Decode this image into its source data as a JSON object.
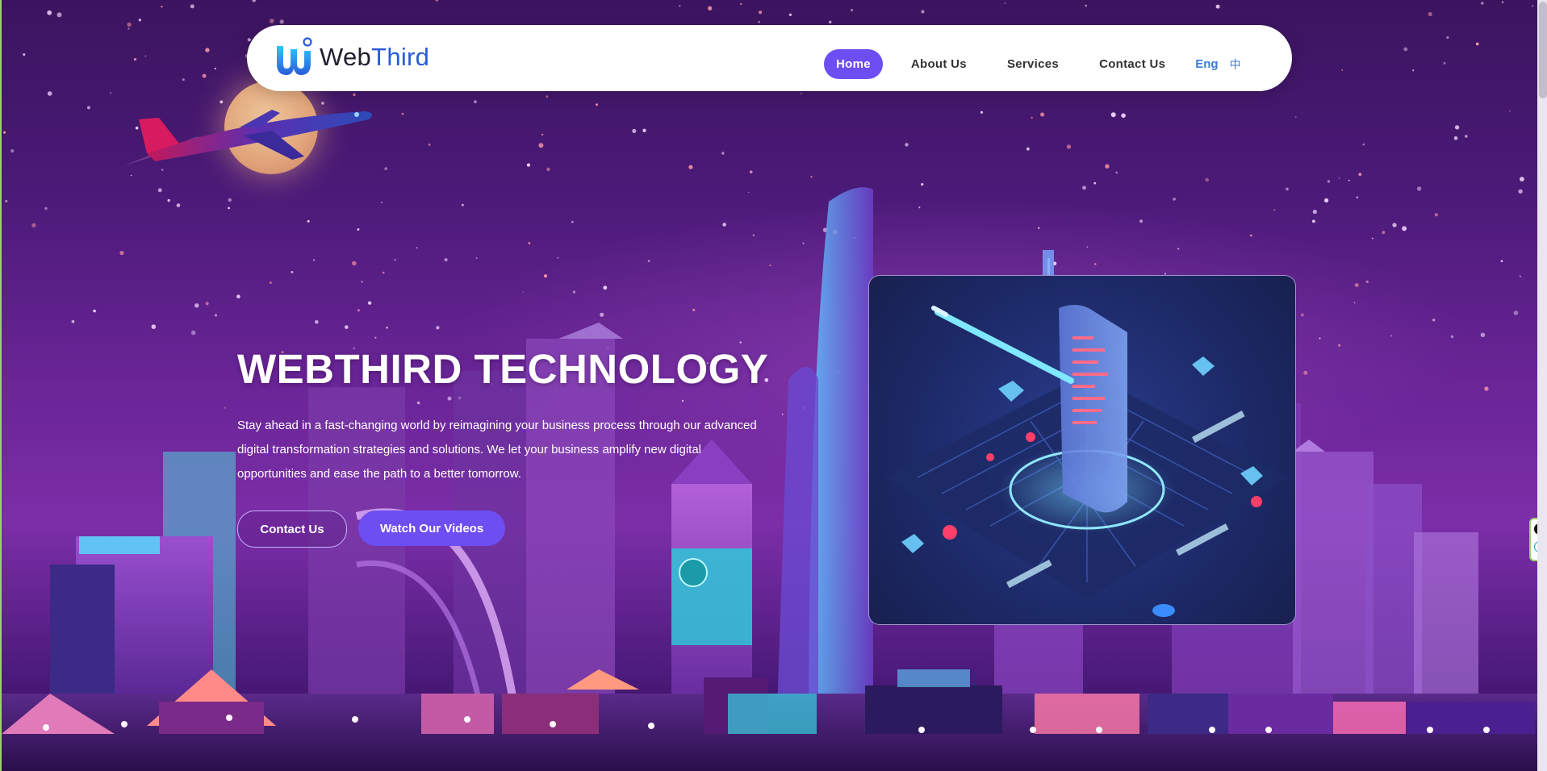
{
  "brand": {
    "logo_text_web": "Web",
    "logo_text_third": "Third",
    "logo_mark_letter": "W"
  },
  "nav": {
    "items": [
      {
        "label": "Home",
        "active": true
      },
      {
        "label": "About Us",
        "active": false
      },
      {
        "label": "Services",
        "active": false
      },
      {
        "label": "Contact Us",
        "active": false
      }
    ],
    "lang_en": "Eng",
    "lang_zh": "中"
  },
  "hero": {
    "title": "WEBTHIRD TECHNOLOGY",
    "description": "Stay ahead in a fast-changing world by reimagining your business process through our advanced digital transformation strategies and solutions. We let your business amplify new digital opportunities and ease the path to a better tomorrow.",
    "btn_contact": "Contact Us",
    "btn_videos": "Watch Our Videos"
  },
  "colors": {
    "accent": "#6c4ef2",
    "nav_bg": "#ffffff",
    "logo_blue": "#2a5bd7"
  },
  "icons": {
    "widget_close": "close-icon",
    "widget_e": "e-icon"
  }
}
